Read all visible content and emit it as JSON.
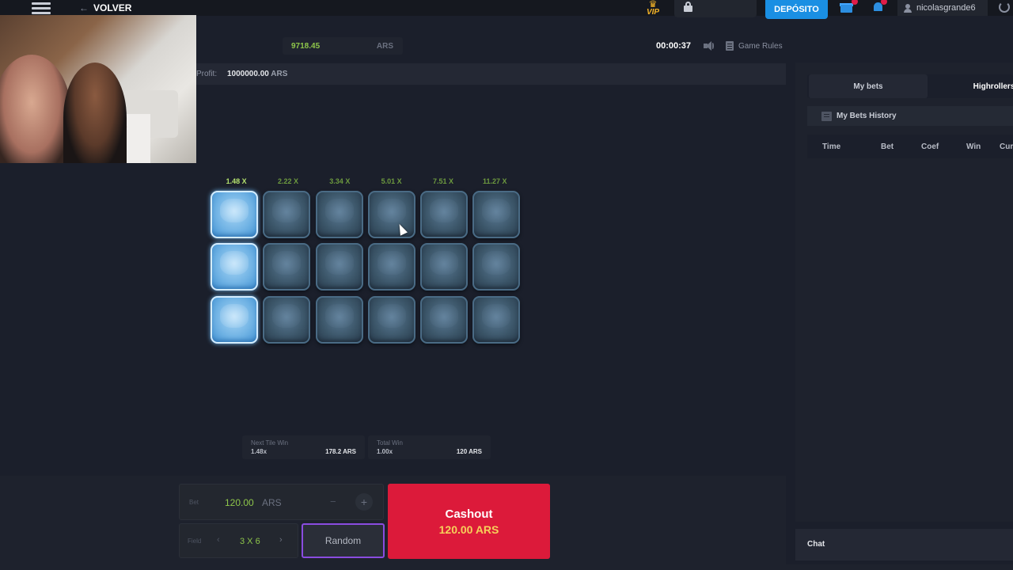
{
  "nav": {
    "back_label": "VOLVER",
    "vip_label": "VIP",
    "deposit_label": "DEPÓSITO",
    "username": "nicolasgrande6"
  },
  "header": {
    "balance_value": "9718.45",
    "balance_currency": "ARS",
    "timer": "00:00:37",
    "game_rules_label": "Game Rules"
  },
  "profit": {
    "label": "Profit:",
    "value": "1000000.00",
    "currency": "ARS"
  },
  "game": {
    "multipliers": [
      "1.48 X",
      "2.22 X",
      "3.34 X",
      "5.01 X",
      "7.51 X",
      "11.27 X"
    ],
    "rows": 3,
    "cols": 6,
    "revealed_column": 1
  },
  "next_tile_win": {
    "title": "Next Tile Win",
    "multiplier": "1.48x",
    "amount": "178.2 ARS"
  },
  "total_win": {
    "title": "Total Win",
    "multiplier": "1.00x",
    "amount": "120 ARS"
  },
  "controls": {
    "bet_label": "Bet",
    "bet_value": "120.00",
    "bet_currency": "ARS",
    "minus_label": "−",
    "plus_label": "+",
    "field_label": "Field",
    "field_value": "3 X 6",
    "field_prev": "‹",
    "field_next": "›",
    "random_label": "Random",
    "cashout_label": "Cashout",
    "cashout_amount": "120.00 ARS"
  },
  "side": {
    "tab_my_bets": "My bets",
    "tab_highrollers": "Highrollers",
    "history_title": "My Bets History",
    "columns": [
      "Time",
      "Bet",
      "Coef",
      "Win",
      "Cur"
    ],
    "chat_label": "Chat"
  },
  "colors": {
    "accent_green": "#8ec64a",
    "cashout_red": "#dc1a3a",
    "deposit_blue": "#1a8fe3",
    "random_border": "#8a4ce0"
  }
}
